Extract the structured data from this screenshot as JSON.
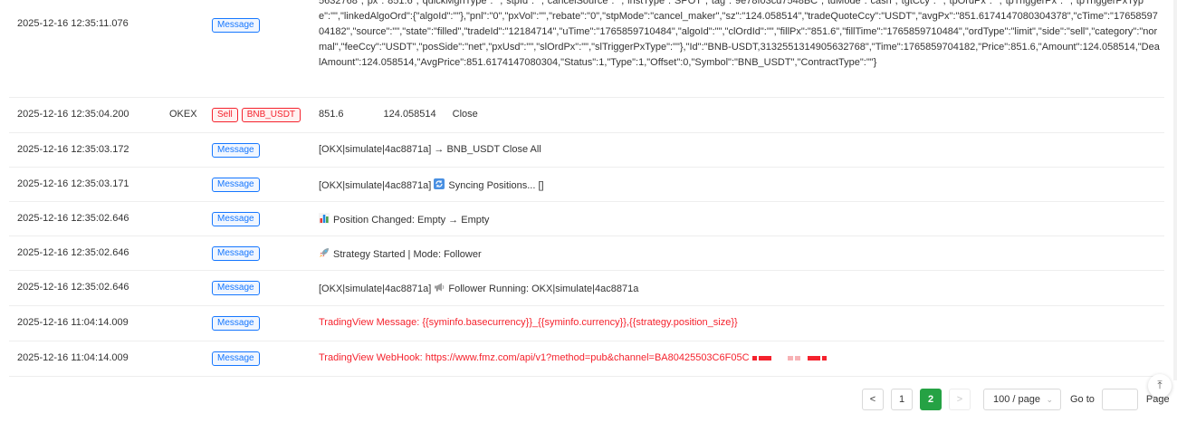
{
  "log": {
    "first_row": {
      "time": "2025-12-16 12:35:11.076",
      "tag": "Message",
      "text": "5632768\",\"px\":\"851.6\",\"quickMgnType\":\"\",\"stpId\":\"\",\"cancelSource\":\"\",\"instType\":\"SPOT\",\"tag\":\"9e78f03cd7548BC\",\"tdMode\":\"cash\",\"tgtCcy\":\"\",\"tpOrdPx\":\"\",\"tpTriggerPx\":\"\",\"tpTriggerPxType\":\"\",\"linkedAlgoOrd\":{\"algoId\":\"\"},\"pnl\":\"0\",\"pxVol\":\"\",\"rebate\":\"0\",\"stpMode\":\"cancel_maker\",\"sz\":\"124.058514\",\"tradeQuoteCcy\":\"USDT\",\"avgPx\":\"851.6174147080304378\",\"cTime\":\"1765859704182\",\"source\":\"\",\"state\":\"filled\",\"tradeId\":\"12184714\",\"uTime\":\"1765859710484\",\"algoId\":\"\",\"clOrdId\":\"\",\"fillPx\":\"851.6\",\"fillTime\":\"1765859710484\",\"ordType\":\"limit\",\"side\":\"sell\",\"category\":\"normal\",\"feeCcy\":\"USDT\",\"posSide\":\"net\",\"pxUsd\":\"\",\"slOrdPx\":\"\",\"slTriggerPxType\":\"\"},\"Id\":\"BNB-USDT,3132551314905632768\",\"Time\":1765859704182,\"Price\":851.6,\"Amount\":124.058514,\"DealAmount\":124.058514,\"AvgPrice\":851.6174147080304,\"Status\":1,\"Type\":1,\"Offset\":0,\"Symbol\":\"BNB_USDT\",\"ContractType\":\"\"}"
    },
    "trade_row": {
      "time": "2025-12-16 12:35:04.200",
      "exchange": "OKEX",
      "side_tag": "Sell",
      "symbol_tag": "BNB_USDT",
      "price": "851.6",
      "amount": "124.058514",
      "action": "Close"
    },
    "rows": [
      {
        "time": "2025-12-16 12:35:03.172",
        "tag": "Message",
        "prefix": "[OKX|simulate|4ac8871a] → BNB_USDT Close All",
        "icon": "",
        "suffix": ""
      },
      {
        "time": "2025-12-16 12:35:03.171",
        "tag": "Message",
        "prefix": "[OKX|simulate|4ac8871a]",
        "icon": "sync-icon",
        "suffix": "Syncing Positions... []"
      },
      {
        "time": "2025-12-16 12:35:02.646",
        "tag": "Message",
        "prefix": "",
        "icon": "bar-chart-icon",
        "suffix": "Position Changed: Empty → Empty"
      },
      {
        "time": "2025-12-16 12:35:02.646",
        "tag": "Message",
        "prefix": "",
        "icon": "rocket-icon",
        "suffix": "Strategy Started | Mode: Follower"
      },
      {
        "time": "2025-12-16 12:35:02.646",
        "tag": "Message",
        "prefix": "[OKX|simulate|4ac8871a]",
        "icon": "megaphone-icon",
        "suffix": "Follower Running: OKX|simulate|4ac8871a"
      },
      {
        "time": "2025-12-16 11:04:14.009",
        "tag": "Message",
        "prefix": "TradingView Message: {{syminfo.basecurrency}}_{{syminfo.currency}},{{strategy.position_size}}",
        "icon": "",
        "suffix": ""
      },
      {
        "time": "2025-12-16 11:04:14.009",
        "tag": "Message",
        "prefix": "TradingView WebHook: https://www.fmz.com/api/v1?method=pub&channel=BA80425503C6F05C",
        "icon": "",
        "suffix": ""
      }
    ]
  },
  "pagination": {
    "prev": "<",
    "pages": [
      "1",
      "2"
    ],
    "next": ">",
    "page_size": "100 / page",
    "goto_label": "Go to",
    "goto_value": "",
    "suffix": "Page",
    "back_top": "⤒"
  },
  "colors": {
    "message_tag": "#1677ff",
    "sell_tag": "#f5222d",
    "error_text": "#f5222d",
    "active_page": "#25a244"
  }
}
